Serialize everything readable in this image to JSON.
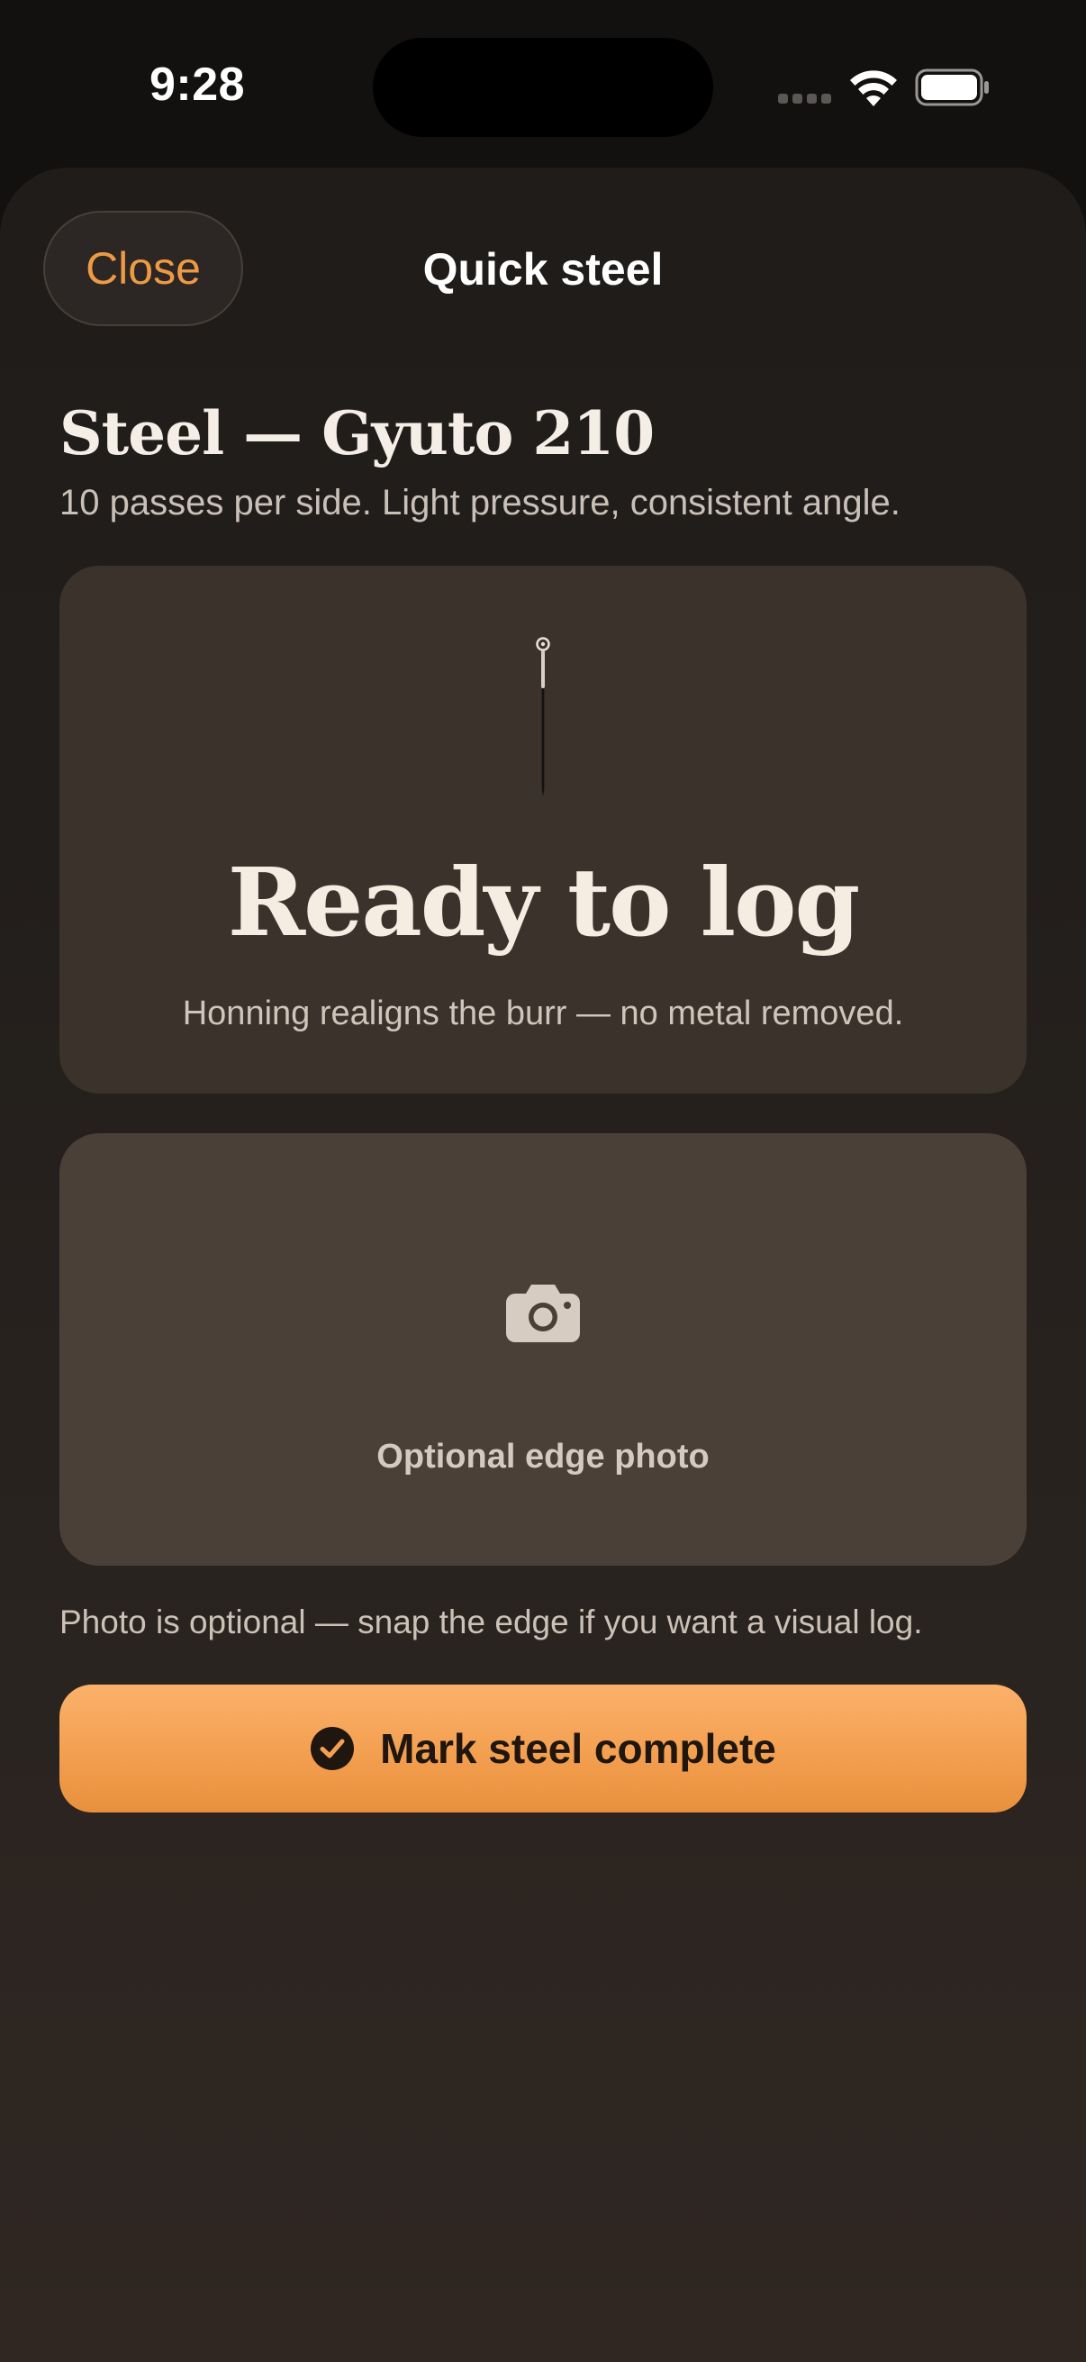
{
  "status_bar": {
    "time": "9:28"
  },
  "nav": {
    "close_label": "Close",
    "title": "Quick steel"
  },
  "content": {
    "title": "Steel — Gyuto 210",
    "subtitle": "10 passes per side. Light pressure, consistent angle."
  },
  "ready_card": {
    "heading": "Ready to log",
    "caption": "Honning realigns the burr — no metal removed."
  },
  "photo_card": {
    "label": "Optional edge photo"
  },
  "hint": "Photo is optional — snap the edge if you want a visual log.",
  "action": {
    "complete_label": "Mark steel complete"
  },
  "colors": {
    "accent": "#ee9a45",
    "button_gradient_top": "#fbb16a",
    "button_gradient_bottom": "#e8903c",
    "card_ready": "#3b322c",
    "card_photo": "#4b4038"
  },
  "icons": {
    "status": [
      "signal-icon",
      "wifi-icon",
      "battery-icon"
    ],
    "ready_card": "honing-steel-icon",
    "photo_card": "camera-icon",
    "action": "check-circle-icon"
  }
}
